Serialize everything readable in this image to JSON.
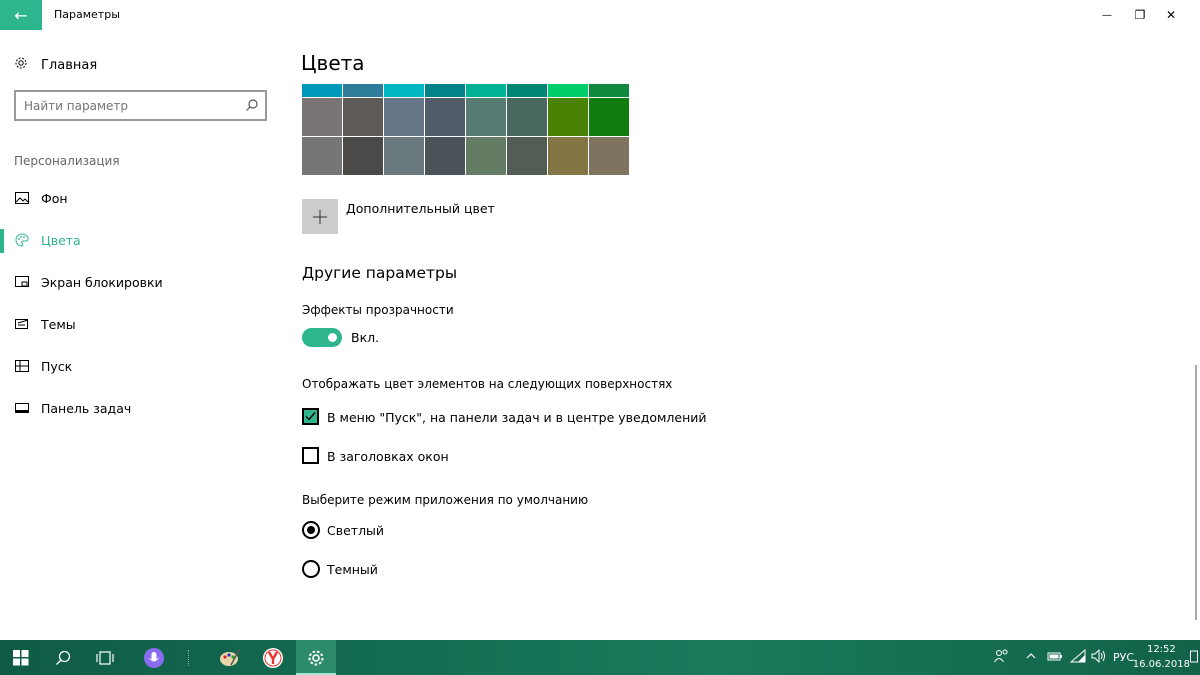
{
  "window": {
    "title": "Параметры",
    "back_glyph": "←",
    "minimize_glyph": "—",
    "maximize_glyph": "❐",
    "close_glyph": "✕"
  },
  "sidebar": {
    "home_label": "Главная",
    "search_placeholder": "Найти параметр",
    "section_title": "Персонализация",
    "items": [
      {
        "label": "Фон",
        "icon": "image-icon"
      },
      {
        "label": "Цвета",
        "icon": "palette-icon",
        "active": true
      },
      {
        "label": "Экран блокировки",
        "icon": "lock-screen-icon"
      },
      {
        "label": "Темы",
        "icon": "themes-icon"
      },
      {
        "label": "Пуск",
        "icon": "start-icon"
      },
      {
        "label": "Панель задач",
        "icon": "taskbar-icon"
      }
    ]
  },
  "main": {
    "title": "Цвета",
    "swatches": {
      "row_top": [
        "#0099bc",
        "#2d7d9a",
        "#00b7c3",
        "#038387",
        "#00b294",
        "#018574",
        "#00cc6a",
        "#10893e"
      ],
      "row_mid": [
        "#7a7574",
        "#5d5a58",
        "#68768a",
        "#515c6b",
        "#567c73",
        "#486860",
        "#498205",
        "#107c10"
      ],
      "row_bottom": [
        "#767676",
        "#4c4a48",
        "#69797e",
        "#4a5459",
        "#647c64",
        "#525e54",
        "#847545",
        "#7e735f"
      ]
    },
    "custom_color_label": "Дополнительный цвет",
    "other_params_heading": "Другие параметры",
    "transparency_label": "Эффекты прозрачности",
    "transparency_state": "Вкл.",
    "surfaces_label": "Отображать цвет элементов на следующих поверхностях",
    "surfaces": [
      {
        "label": "В меню \"Пуск\", на панели задач и в центре уведомлений",
        "checked": true
      },
      {
        "label": "В заголовках окон",
        "checked": false
      }
    ],
    "app_mode_label": "Выберите режим приложения по умолчанию",
    "app_modes": [
      {
        "label": "Светлый",
        "selected": true
      },
      {
        "label": "Темный",
        "selected": false
      }
    ]
  },
  "taskbar": {
    "language": "РУС",
    "time": "12:52",
    "date": "16.06.2018"
  },
  "colors": {
    "accent": "#2db58e",
    "taskbar": "#136b51"
  }
}
